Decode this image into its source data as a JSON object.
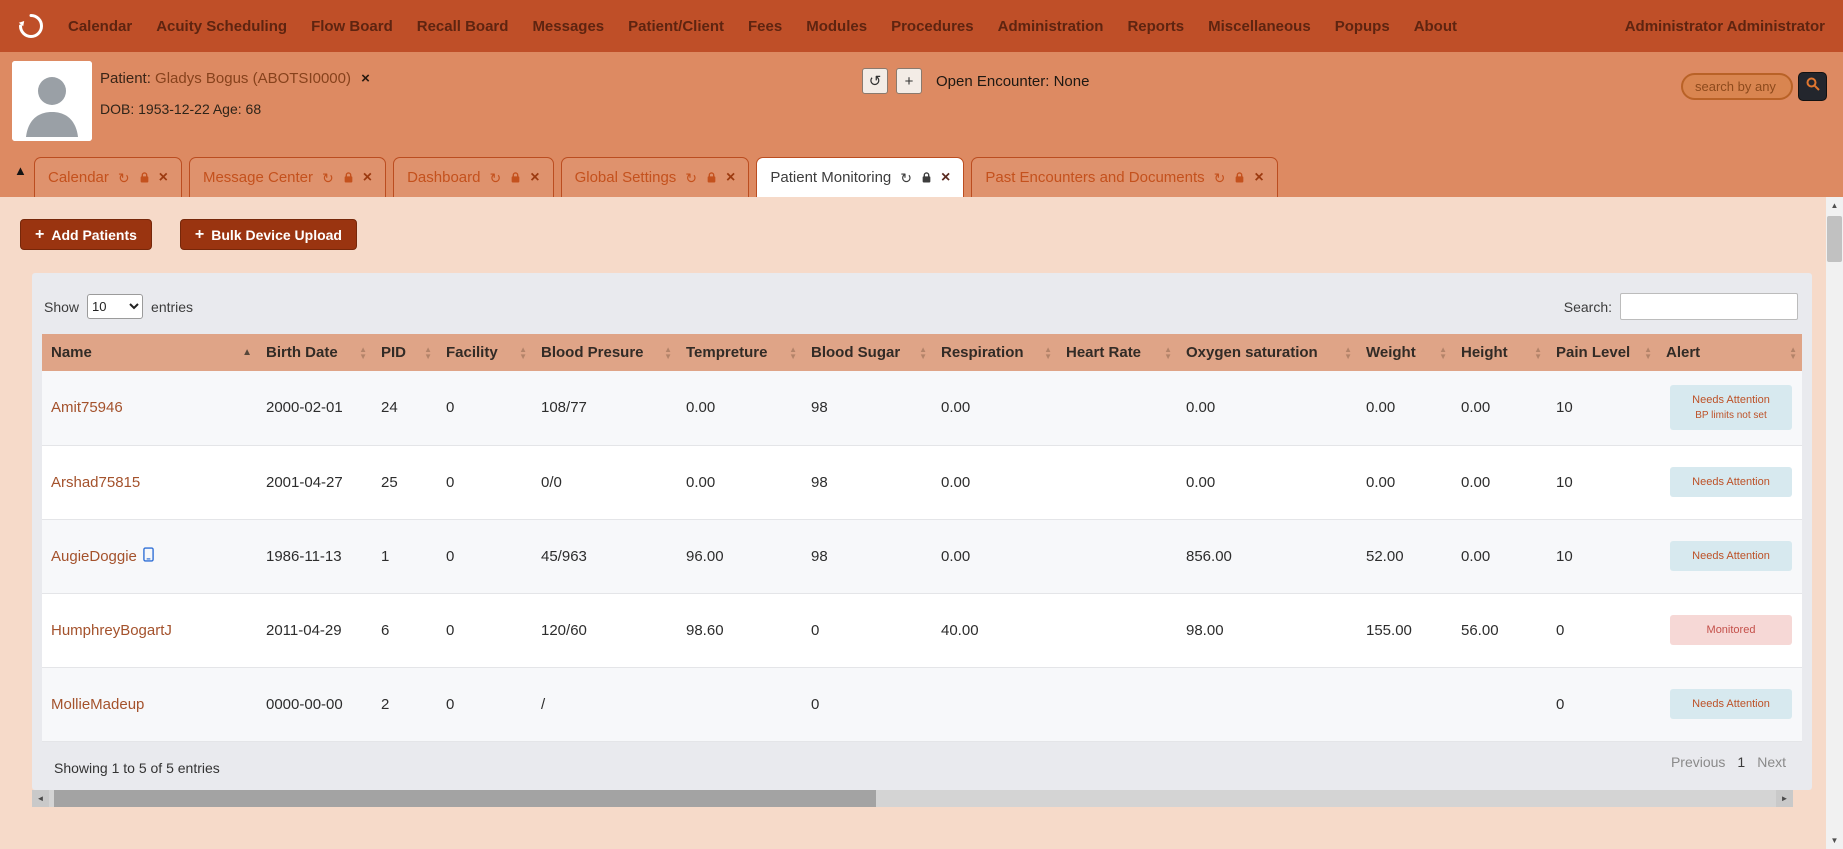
{
  "icons": {
    "refresh": "↻",
    "history": "↺",
    "close": "×",
    "plus": "+",
    "sort_up": "▲",
    "sort_down": "▼",
    "collapse": "▲",
    "left": "◄",
    "right": "►",
    "up": "▲",
    "down": "▼"
  },
  "colors": {
    "topnav": "#bf4f28",
    "patient_bar": "#dd8a62",
    "content_bg": "#f6dac9",
    "table_header": "#dfa487",
    "badge_info_bg": "#d7e9ef",
    "badge_monitored_bg": "#f6d8d6",
    "action_button": "#9a3410"
  },
  "nav": {
    "items": [
      "Calendar",
      "Acuity Scheduling",
      "Flow Board",
      "Recall Board",
      "Messages",
      "Patient/Client",
      "Fees",
      "Modules",
      "Procedures",
      "Administration",
      "Reports",
      "Miscellaneous",
      "Popups",
      "About"
    ],
    "user": "Administrator Administrator"
  },
  "patient_bar": {
    "patient_label": "Patient:",
    "patient_name": "Gladys Bogus (ABOTSI0000)",
    "dob_line": "DOB: 1953-12-22 Age: 68",
    "open_encounter_label": "Open Encounter: None",
    "search_placeholder": "search by any d"
  },
  "tabs": [
    {
      "label": "Calendar",
      "active": false
    },
    {
      "label": "Message Center",
      "active": false
    },
    {
      "label": "Dashboard",
      "active": false
    },
    {
      "label": "Global Settings",
      "active": false
    },
    {
      "label": "Patient Monitoring",
      "active": true
    },
    {
      "label": "Past Encounters and Documents",
      "active": false
    }
  ],
  "actions": {
    "add_patients_label": "Add Patients",
    "bulk_device_upload_label": "Bulk Device Upload"
  },
  "table": {
    "show_label": "Show",
    "page_length": "10",
    "entries_label": "entries",
    "search_label": "Search:",
    "columns": [
      "Name",
      "Birth Date",
      "PID",
      "Facility",
      "Blood Presure",
      "Tempreture",
      "Blood Sugar",
      "Respiration",
      "Heart Rate",
      "Oxygen saturation",
      "Weight",
      "Height",
      "Pain Level",
      "Alert"
    ],
    "rows": [
      {
        "name": "Amit75946",
        "birth_date": "2000-02-01",
        "pid": "24",
        "facility": "0",
        "blood_pressure": "108/77",
        "temperature": "0.00",
        "blood_sugar": "98",
        "respiration": "0.00",
        "heart_rate": "",
        "oxygen_saturation": "0.00",
        "weight": "0.00",
        "height": "0.00",
        "pain_level": "10",
        "alert": "Needs Attention",
        "alert_line2": "BP limits not set",
        "alert_type": "info",
        "device_icon": false
      },
      {
        "name": "Arshad75815",
        "birth_date": "2001-04-27",
        "pid": "25",
        "facility": "0",
        "blood_pressure": "0/0",
        "temperature": "0.00",
        "blood_sugar": "98",
        "respiration": "0.00",
        "heart_rate": "",
        "oxygen_saturation": "0.00",
        "weight": "0.00",
        "height": "0.00",
        "pain_level": "10",
        "alert": "Needs Attention",
        "alert_line2": "",
        "alert_type": "info",
        "device_icon": false
      },
      {
        "name": "AugieDoggie",
        "birth_date": "1986-11-13",
        "pid": "1",
        "facility": "0",
        "blood_pressure": "45/963",
        "temperature": "96.00",
        "blood_sugar": "98",
        "respiration": "0.00",
        "heart_rate": "",
        "oxygen_saturation": "856.00",
        "weight": "52.00",
        "height": "0.00",
        "pain_level": "10",
        "alert": "Needs Attention",
        "alert_line2": "",
        "alert_type": "info",
        "device_icon": true
      },
      {
        "name": "HumphreyBogartJ",
        "birth_date": "2011-04-29",
        "pid": "6",
        "facility": "0",
        "blood_pressure": "120/60",
        "temperature": "98.60",
        "blood_sugar": "0",
        "respiration": "40.00",
        "heart_rate": "",
        "oxygen_saturation": "98.00",
        "weight": "155.00",
        "height": "56.00",
        "pain_level": "0",
        "alert": "Monitored",
        "alert_line2": "",
        "alert_type": "monitored",
        "device_icon": false
      },
      {
        "name": "MollieMadeup",
        "birth_date": "0000-00-00",
        "pid": "2",
        "facility": "0",
        "blood_pressure": "/",
        "temperature": "",
        "blood_sugar": "0",
        "respiration": "",
        "heart_rate": "",
        "oxygen_saturation": "",
        "weight": "",
        "height": "",
        "pain_level": "0",
        "alert": "Needs Attention",
        "alert_line2": "",
        "alert_type": "info",
        "device_icon": false
      }
    ],
    "footer_text": "Showing 1 to 5 of 5 entries",
    "pagination": {
      "previous": "Previous",
      "current_page": "1",
      "next": "Next"
    }
  }
}
